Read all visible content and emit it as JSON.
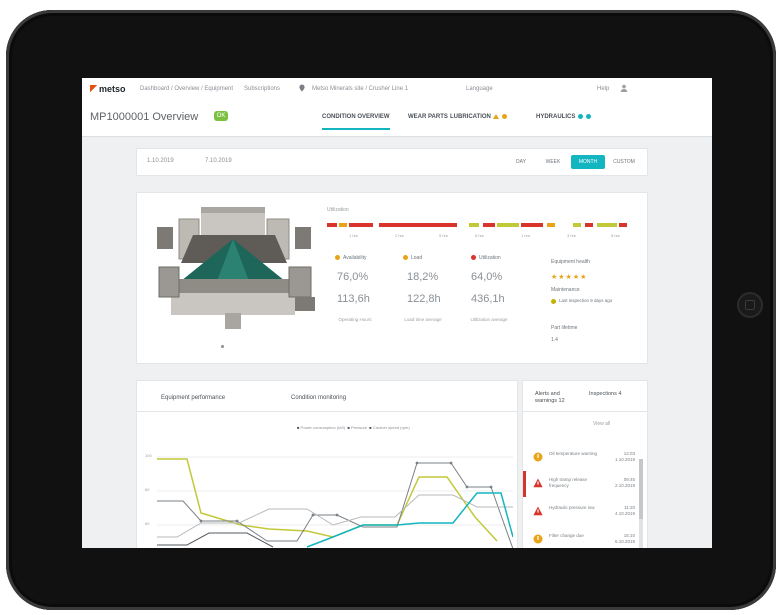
{
  "app": {
    "logo": "metso",
    "topbar": {
      "breadcrumb_1": "Dashboard / Overview / Equipment",
      "breadcrumb_2": "Subscriptions",
      "site": "Metso Minerals site / Crusher Line 1",
      "user": "Language",
      "help": "Help"
    }
  },
  "header": {
    "title": "MP1000001 Overview",
    "badge": "OK",
    "tabs": [
      {
        "label": "CONDITION OVERVIEW"
      },
      {
        "label": "WEAR PARTS"
      },
      {
        "label": "LUBRICATION"
      },
      {
        "label": "HYDRAULICS"
      }
    ]
  },
  "filter": {
    "from": "1.10.2019",
    "to": "7.10.2019",
    "ranges": [
      "DAY",
      "WEEK",
      "MONTH",
      "CUSTOM"
    ],
    "active_range": "MONTH"
  },
  "equipment": {
    "legend_label": "Utilization",
    "bar_labels": [
      "1 hrs",
      "2 hrs",
      "5 hrs",
      "8 hrs",
      "1 hrs",
      "3 hrs",
      "5 hrs"
    ],
    "metrics": [
      {
        "name": "Availability",
        "color": "#e8a317",
        "v1": "76,0%",
        "v2": "113,6h",
        "sub": "Operating Hours"
      },
      {
        "name": "Load",
        "color": "#e8a317",
        "v1": "18,2%",
        "v2": "122,8h",
        "sub": "Load time average"
      },
      {
        "name": "Utilization",
        "color": "#d9342b",
        "v1": "64,0%",
        "v2": "436,1h",
        "sub": "Utilization average"
      }
    ],
    "side": {
      "rating_label": "Equipment health",
      "stars": "★★★★★",
      "status_label": "Maintenance",
      "status_text": "Last inspection 9 days ago",
      "extra_label": "Part lifetime",
      "extra_value": "1.4"
    }
  },
  "charts": {
    "tabs": [
      "Equipment performance",
      "Condition monitoring"
    ],
    "legend": [
      "Power consumption (kW)",
      "Pressure",
      "Crusher speed (rpm)"
    ],
    "y_labels": [
      "100",
      "80",
      "60",
      "40"
    ]
  },
  "alerts": {
    "tab_1": "Alerts and warnings",
    "tab_1_count": "12",
    "tab_2": "Inspections",
    "tab_2_count": "4",
    "header": "View all",
    "rows": [
      {
        "text": "Oil temperature warning",
        "time": "12:03 1.10.2019",
        "color": "#e8a317",
        "kind": "circle"
      },
      {
        "text": "High tramp release frequency",
        "time": "09:45 2.10.2019",
        "color": "#d9342b",
        "kind": "triangle"
      },
      {
        "text": "Hydraulic pressure low",
        "time": "11:20 4.10.2019",
        "color": "#d9342b",
        "kind": "triangle"
      },
      {
        "text": "Filter change due",
        "time": "15:10 6.10.2019",
        "color": "#e8a317",
        "kind": "circle"
      }
    ]
  }
}
